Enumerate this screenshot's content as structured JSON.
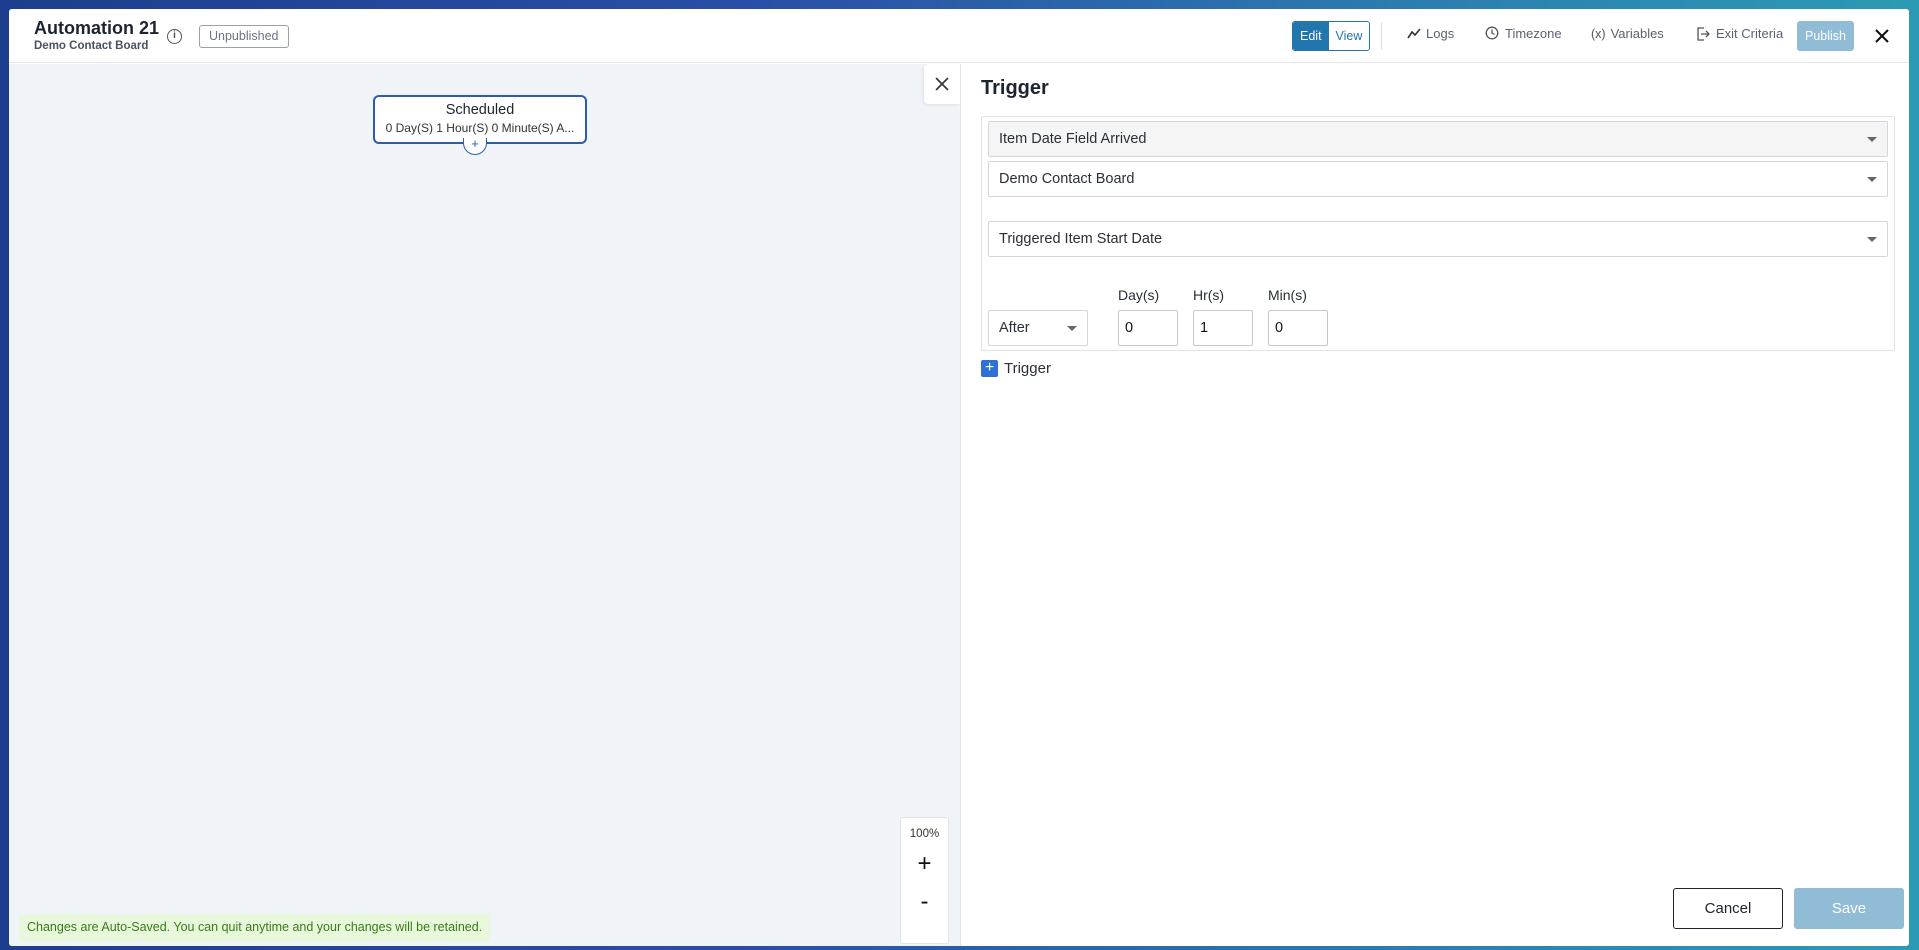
{
  "header": {
    "title": "Automation 21",
    "subtitle": "Demo Contact Board",
    "status_badge": "Unpublished",
    "mode_edit": "Edit",
    "mode_view": "View",
    "logs_label": "Logs",
    "timezone_label": "Timezone",
    "variables_label": "Variables",
    "exit_criteria_label": "Exit Criteria",
    "publish_label": "Publish"
  },
  "canvas": {
    "node": {
      "title": "Scheduled",
      "subtitle": "0 Day(S) 1 Hour(S) 0 Minute(S) A..."
    },
    "zoom_level": "100%",
    "zoom_in": "+",
    "zoom_out": "-",
    "autosave_notice": "Changes are Auto-Saved. You can quit anytime and your changes will be retained."
  },
  "panel": {
    "title": "Trigger",
    "trigger_type": "Item Date Field Arrived",
    "board": "Demo Contact Board",
    "date_field": "Triggered Item Start Date",
    "timing": "After",
    "days_label": "Day(s)",
    "hours_label": "Hr(s)",
    "minutes_label": "Min(s)",
    "days_value": "0",
    "hours_value": "1",
    "minutes_value": "0",
    "add_trigger_label": "Trigger",
    "cancel_label": "Cancel",
    "save_label": "Save"
  },
  "colors": {
    "accent": "#2176ae",
    "node_border": "#2a5db0",
    "disabled_button": "#90bcd6",
    "autosave_bg": "#e8f8da",
    "autosave_text": "#3a7a1e"
  },
  "icons": {
    "info": "info-icon",
    "logs": "chart-line-icon",
    "timezone": "clock-globe-icon",
    "variables": "variable-icon",
    "exit_criteria": "exit-icon",
    "close": "close-icon"
  }
}
